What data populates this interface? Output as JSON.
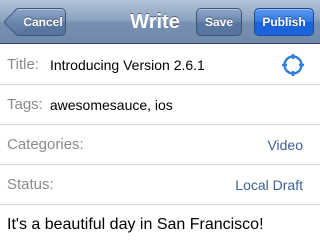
{
  "navbar": {
    "cancel_label": "Cancel",
    "title": "Write",
    "save_label": "Save",
    "publish_label": "Publish"
  },
  "form": {
    "title": {
      "label": "Title:",
      "value": "Introducing Version 2.6.1",
      "icon": "crosshair-icon"
    },
    "tags": {
      "label": "Tags:",
      "value": "awesomesauce, ios"
    },
    "categories": {
      "label": "Categories:",
      "value": "Video"
    },
    "status": {
      "label": "Status:",
      "value": "Local Draft"
    }
  },
  "content": {
    "body": "It's a beautiful day in San Francisco!"
  },
  "colors": {
    "accent_blue": "#1d63db",
    "detail_text": "#3f5f95",
    "icon_blue": "#2f7fe0",
    "label_gray": "#8a8a8a"
  }
}
